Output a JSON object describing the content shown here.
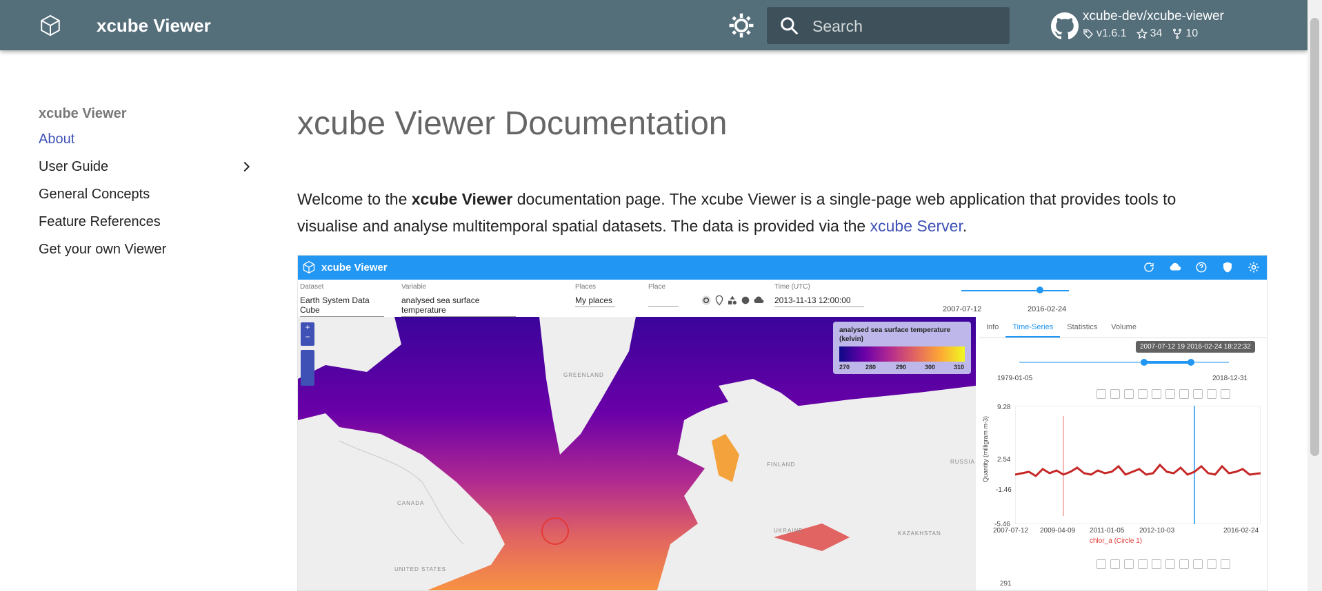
{
  "header": {
    "site_title": "xcube Viewer",
    "search_placeholder": "Search",
    "repo": {
      "name": "xcube-dev/xcube-viewer",
      "version": "v1.6.1",
      "stars": "34",
      "forks": "10"
    }
  },
  "sidebar": {
    "title": "xcube Viewer",
    "items": [
      {
        "label": "About",
        "active": true
      },
      {
        "label": "User Guide",
        "has_children": true
      },
      {
        "label": "General Concepts"
      },
      {
        "label": "Feature References"
      },
      {
        "label": "Get your own Viewer"
      }
    ]
  },
  "content": {
    "heading": "xcube Viewer Documentation",
    "intro_before_bold": "Welcome to the ",
    "intro_bold": "xcube Viewer",
    "intro_mid": " documentation page. The xcube Viewer is a single-page web application that provides tools to visualise and analyse multitemporal spatial datasets. The data is provided via the ",
    "intro_link": "xcube Server",
    "intro_end": "."
  },
  "screenshot": {
    "app_title": "xcube Viewer",
    "dataset_label": "Dataset",
    "dataset_value": "Earth System Data Cube",
    "variable_label": "Variable",
    "variable_value": "analysed sea surface temperature",
    "places_label": "Places",
    "places_value": "My places",
    "place_label": "Place",
    "time_label": "Time (UTC)",
    "time_value": "2013-11-13 12:00:00",
    "range_start": "2007-07-12",
    "range_end": "2016-02-24",
    "legend_title": "analysed sea surface temperature (kelvin)",
    "legend_ticks": [
      "270",
      "280",
      "290",
      "300",
      "310"
    ],
    "map_labels": {
      "greenland": "GREENLAND",
      "finland": "FINLAND",
      "russia": "RUSSIA",
      "canada": "CANADA",
      "kazakhstan": "KAZAKHSTAN",
      "ukraine": "UKRAINE",
      "united_states": "UNITED STATES"
    },
    "tabs": [
      "Info",
      "Time-Series",
      "Statistics",
      "Volume"
    ],
    "tooltip": "2007-07-12 19   2016-02-24 18:22:32",
    "slider_start": "1979-01-05",
    "slider_end": "2018-12-31",
    "plot1": {
      "ylabel": "Quantity (milligram m-3)",
      "yticks": [
        "9.28",
        "2.54",
        "-1.46",
        "-5.46"
      ],
      "xticks": [
        "2007-07-12",
        "2009-04-09",
        "2011-01-05",
        "2012-10-03",
        "2016-02-24"
      ],
      "series": "chlor_a (Circle 1)"
    },
    "plot2": {
      "ytop": "291"
    }
  },
  "colors": {
    "header_bg": "#546e7a",
    "link": "#3f51b5",
    "app_bar": "#2196f3"
  }
}
